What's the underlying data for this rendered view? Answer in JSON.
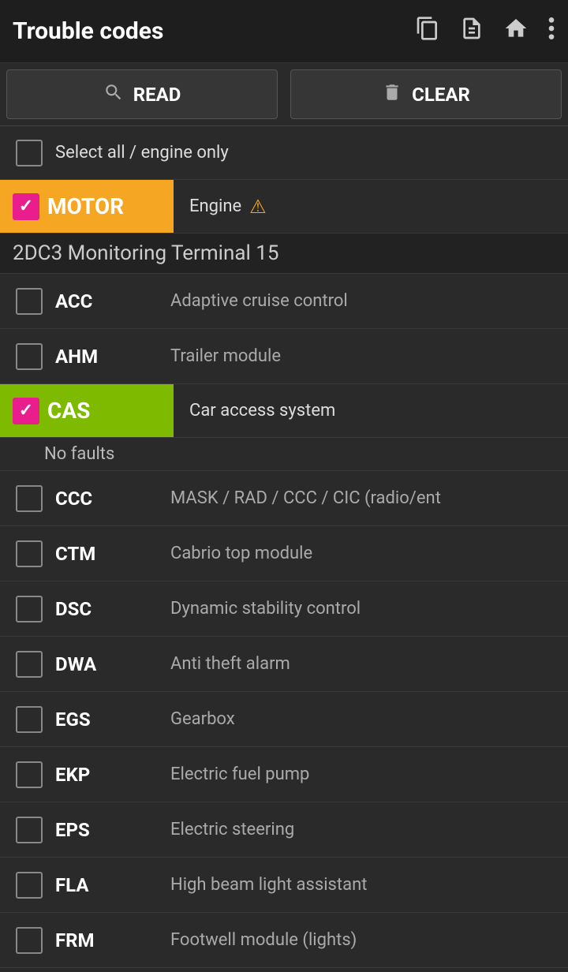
{
  "header": {
    "title": "Trouble codes",
    "icons": [
      "copy",
      "document",
      "home",
      "more"
    ]
  },
  "toolbar": {
    "read_label": "READ",
    "clear_label": "CLEAR"
  },
  "select_all": {
    "label": "Select all / engine only",
    "checked": false
  },
  "motor_module": {
    "tag": "MOTOR",
    "description": "Engine",
    "checked": true,
    "has_warning": true
  },
  "section_title": "2DC3 Monitoring Terminal 15",
  "modules": [
    {
      "code": "ACC",
      "description": "Adaptive cruise control",
      "checked": false,
      "highlight": false,
      "no_faults": false
    },
    {
      "code": "AHM",
      "description": "Trailer module",
      "checked": false,
      "highlight": false,
      "no_faults": false
    },
    {
      "code": "CAS",
      "description": "Car access system",
      "checked": true,
      "highlight": true,
      "no_faults": true
    },
    {
      "code": "CCC",
      "description": "MASK / RAD / CCC / CIC (radio/ent",
      "checked": false,
      "highlight": false,
      "no_faults": false
    },
    {
      "code": "CTM",
      "description": "Cabrio top module",
      "checked": false,
      "highlight": false,
      "no_faults": false
    },
    {
      "code": "DSC",
      "description": "Dynamic stability control",
      "checked": false,
      "highlight": false,
      "no_faults": false
    },
    {
      "code": "DWA",
      "description": "Anti theft alarm",
      "checked": false,
      "highlight": false,
      "no_faults": false
    },
    {
      "code": "EGS",
      "description": "Gearbox",
      "checked": false,
      "highlight": false,
      "no_faults": false
    },
    {
      "code": "EKP",
      "description": "Electric fuel pump",
      "checked": false,
      "highlight": false,
      "no_faults": false
    },
    {
      "code": "EPS",
      "description": "Electric steering",
      "checked": false,
      "highlight": false,
      "no_faults": false
    },
    {
      "code": "FLA",
      "description": "High beam light assistant",
      "checked": false,
      "highlight": false,
      "no_faults": false
    },
    {
      "code": "FRM",
      "description": "Footwell module (lights)",
      "checked": false,
      "highlight": false,
      "no_faults": false
    }
  ],
  "no_faults_label": "No faults"
}
